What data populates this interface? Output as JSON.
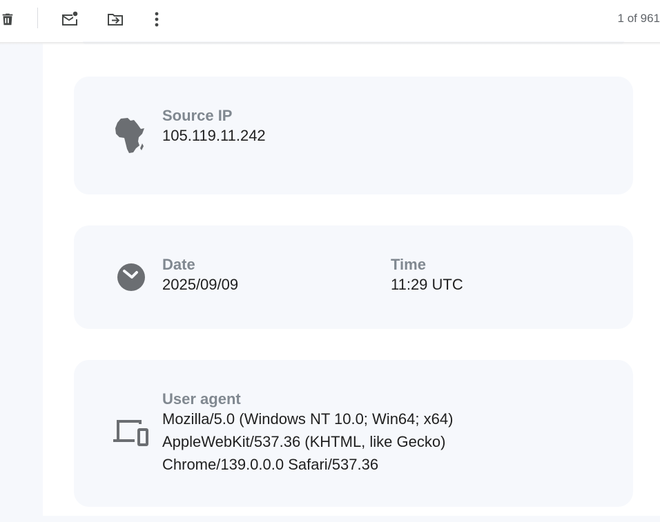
{
  "toolbar": {
    "delete_icon": "trash-icon",
    "mark_unread_icon": "mark-unread-icon",
    "move_to_icon": "move-to-folder-icon",
    "more_icon": "more-vert-icon",
    "pager": "1 of 961"
  },
  "source_ip": {
    "icon": "africa-icon",
    "label": "Source IP",
    "value": "105.119.11.242"
  },
  "datetime": {
    "icon": "clock-icon",
    "date_label": "Date",
    "date_value": "2025/09/09",
    "time_label": "Time",
    "time_value": "11:29 UTC"
  },
  "user_agent": {
    "icon": "devices-icon",
    "label": "User agent",
    "lines": [
      "Mozilla/5.0 (Windows NT 10.0; Win64; x64)",
      "AppleWebKit/537.36 (KHTML, like Gecko)",
      "Chrome/139.0.0.0 Safari/537.36"
    ]
  },
  "colors": {
    "card_bg": "#f6f8fc",
    "label": "#808890",
    "value": "#1f1f1f",
    "icon": "#6b6e72"
  }
}
